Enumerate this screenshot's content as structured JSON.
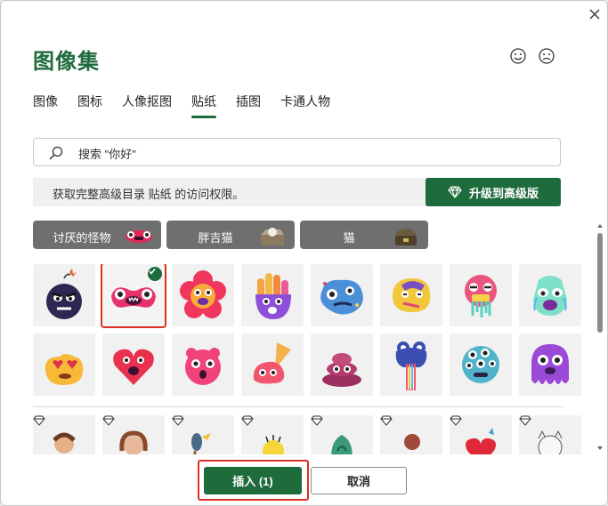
{
  "dialog": {
    "title": "图像集",
    "close_icon": "close-icon",
    "feedback_icons": [
      "smile-icon",
      "frown-icon"
    ]
  },
  "tabs": [
    {
      "label": "图像",
      "active": false
    },
    {
      "label": "图标",
      "active": false
    },
    {
      "label": "人像抠图",
      "active": false
    },
    {
      "label": "贴纸",
      "active": true
    },
    {
      "label": "插图",
      "active": false
    },
    {
      "label": "卡通人物",
      "active": false
    }
  ],
  "search": {
    "placeholder": "搜索 \"你好\"",
    "icon": "search-icon"
  },
  "banner": {
    "text": "获取完整高级目录 贴纸 的访问权限。",
    "upgrade_label": "升级到高级版",
    "upgrade_icon": "diamond-icon"
  },
  "categories": [
    {
      "label": "讨厌的怪物"
    },
    {
      "label": "胖吉猫"
    },
    {
      "label": "猫"
    }
  ],
  "stickers": {
    "row1": [
      {
        "name": "bomb-monster",
        "selected": false
      },
      {
        "name": "pink-blob-monster",
        "selected": true
      },
      {
        "name": "flower-monster",
        "selected": false
      },
      {
        "name": "hand-monster",
        "selected": false
      },
      {
        "name": "blue-splat-monster",
        "selected": false
      },
      {
        "name": "yellow-dizzy-monster",
        "selected": false
      },
      {
        "name": "red-drooling-monster",
        "selected": false
      },
      {
        "name": "crying-monster",
        "selected": false
      }
    ],
    "row2": [
      {
        "name": "love-eyes-blob"
      },
      {
        "name": "heart-monster"
      },
      {
        "name": "pink-bubble-monster"
      },
      {
        "name": "ice-cream-monster"
      },
      {
        "name": "poop-monster"
      },
      {
        "name": "rainbow-frog-monster"
      },
      {
        "name": "many-eyes-monster"
      },
      {
        "name": "purple-slime-monster"
      }
    ],
    "premium_row": [
      {
        "name": "cartoon-man-premium"
      },
      {
        "name": "cartoon-girl-premium"
      },
      {
        "name": "cartoon-bird-premium"
      },
      {
        "name": "yellow-creature-premium"
      },
      {
        "name": "plant-monster-premium"
      },
      {
        "name": "woodcut-figure-premium"
      },
      {
        "name": "red-heart-premium"
      },
      {
        "name": "cat-premium"
      }
    ]
  },
  "footer": {
    "insert_label": "插入 (1)",
    "cancel_label": "取消"
  },
  "colors": {
    "brand_green": "#1e6b3c",
    "selection_red": "#d93025",
    "category_gray": "#6f6f6f"
  }
}
